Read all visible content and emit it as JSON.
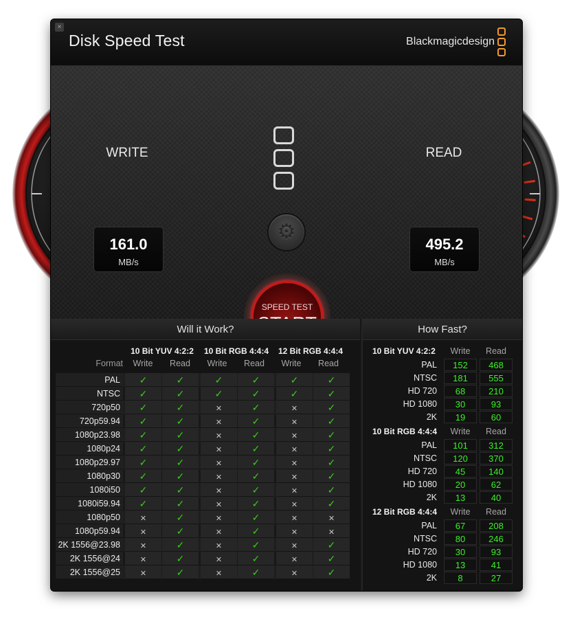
{
  "window": {
    "title": "Disk Speed Test",
    "brand": "Blackmagicdesign",
    "close_icon": "close-icon"
  },
  "colors": {
    "needle": "#1aaee8",
    "write_ring": "#c21b1b",
    "checkmark": "#38d11a",
    "speed_value": "#3cf02a",
    "start_glow": "#e61e1e",
    "logo_orange": "#f29a2e"
  },
  "gauges": {
    "write": {
      "label": "WRITE",
      "value": "161.0",
      "unit": "MB/s"
    },
    "read": {
      "label": "READ",
      "value": "495.2",
      "unit": "MB/s"
    }
  },
  "start_button": {
    "small": "SPEED TEST",
    "big": "START"
  },
  "settings_icon": "gear-icon",
  "will_it_work": {
    "title": "Will it Work?",
    "format_label": "Format",
    "groups": [
      "10 Bit YUV 4:2:2",
      "10 Bit RGB 4:4:4",
      "12 Bit RGB 4:4:4"
    ],
    "col_write": "Write",
    "col_read": "Read",
    "rows": [
      {
        "format": "PAL",
        "cells": [
          1,
          1,
          1,
          1,
          1,
          1
        ]
      },
      {
        "format": "NTSC",
        "cells": [
          1,
          1,
          1,
          1,
          1,
          1
        ]
      },
      {
        "format": "720p50",
        "cells": [
          1,
          1,
          0,
          1,
          0,
          1
        ]
      },
      {
        "format": "720p59.94",
        "cells": [
          1,
          1,
          0,
          1,
          0,
          1
        ]
      },
      {
        "format": "1080p23.98",
        "cells": [
          1,
          1,
          0,
          1,
          0,
          1
        ]
      },
      {
        "format": "1080p24",
        "cells": [
          1,
          1,
          0,
          1,
          0,
          1
        ]
      },
      {
        "format": "1080p29.97",
        "cells": [
          1,
          1,
          0,
          1,
          0,
          1
        ]
      },
      {
        "format": "1080p30",
        "cells": [
          1,
          1,
          0,
          1,
          0,
          1
        ]
      },
      {
        "format": "1080i50",
        "cells": [
          1,
          1,
          0,
          1,
          0,
          1
        ]
      },
      {
        "format": "1080i59.94",
        "cells": [
          1,
          1,
          0,
          1,
          0,
          1
        ]
      },
      {
        "format": "1080p50",
        "cells": [
          0,
          1,
          0,
          1,
          0,
          0
        ]
      },
      {
        "format": "1080p59.94",
        "cells": [
          0,
          1,
          0,
          1,
          0,
          0
        ]
      },
      {
        "format": "2K 1556@23.98",
        "cells": [
          0,
          1,
          0,
          1,
          0,
          1
        ]
      },
      {
        "format": "2K 1556@24",
        "cells": [
          0,
          1,
          0,
          1,
          0,
          1
        ]
      },
      {
        "format": "2K 1556@25",
        "cells": [
          0,
          1,
          0,
          1,
          0,
          1
        ]
      }
    ]
  },
  "how_fast": {
    "title": "How Fast?",
    "col_write": "Write",
    "col_read": "Read",
    "groups": [
      {
        "name": "10 Bit YUV 4:2:2",
        "rows": [
          {
            "label": "PAL",
            "write": "152",
            "read": "468"
          },
          {
            "label": "NTSC",
            "write": "181",
            "read": "555"
          },
          {
            "label": "HD 720",
            "write": "68",
            "read": "210"
          },
          {
            "label": "HD 1080",
            "write": "30",
            "read": "93"
          },
          {
            "label": "2K",
            "write": "19",
            "read": "60"
          }
        ]
      },
      {
        "name": "10 Bit RGB 4:4:4",
        "rows": [
          {
            "label": "PAL",
            "write": "101",
            "read": "312"
          },
          {
            "label": "NTSC",
            "write": "120",
            "read": "370"
          },
          {
            "label": "HD 720",
            "write": "45",
            "read": "140"
          },
          {
            "label": "HD 1080",
            "write": "20",
            "read": "62"
          },
          {
            "label": "2K",
            "write": "13",
            "read": "40"
          }
        ]
      },
      {
        "name": "12 Bit RGB 4:4:4",
        "rows": [
          {
            "label": "PAL",
            "write": "67",
            "read": "208"
          },
          {
            "label": "NTSC",
            "write": "80",
            "read": "246"
          },
          {
            "label": "HD 720",
            "write": "30",
            "read": "93"
          },
          {
            "label": "HD 1080",
            "write": "13",
            "read": "41"
          },
          {
            "label": "2K",
            "write": "8",
            "read": "27"
          }
        ]
      }
    ]
  }
}
